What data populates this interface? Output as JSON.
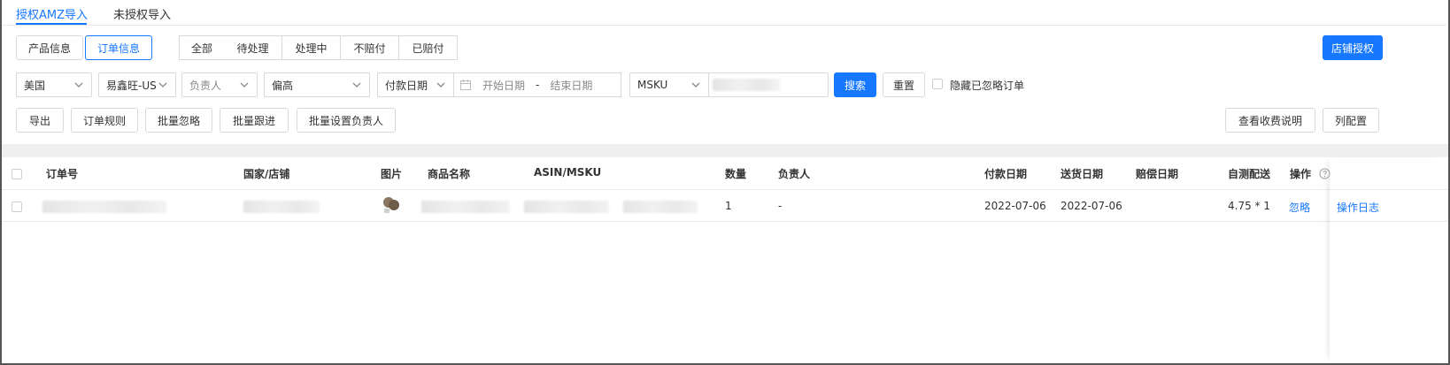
{
  "tabs": [
    {
      "label": "授权AMZ导入",
      "active": true
    },
    {
      "label": "未授权导入",
      "active": false
    }
  ],
  "view_toggle": {
    "product": "产品信息",
    "order": "订单信息"
  },
  "status_filter": [
    "全部",
    "待处理",
    "处理中",
    "不赔付",
    "已赔付"
  ],
  "store_auth_button": "店铺授权",
  "filters": {
    "country": "美国",
    "store": "易鑫旺-US",
    "owner_placeholder": "负责人",
    "type": "偏高",
    "date_type": "付款日期",
    "start_placeholder": "开始日期",
    "end_placeholder": "结束日期",
    "range_sep": "-",
    "sku_type": "MSKU",
    "search": "搜索",
    "reset": "重置",
    "hide_ignored": "隐藏已忽略订单"
  },
  "actions": [
    "导出",
    "订单规则",
    "批量忽略",
    "批量跟进",
    "批量设置负责人"
  ],
  "right_actions": {
    "fee_desc": "查看收费说明",
    "columns": "列配置"
  },
  "table": {
    "headers": {
      "order_no": "订单号",
      "country_store": "国家/店铺",
      "image": "图片",
      "product_name": "商品名称",
      "asin_msku": "ASIN/MSKU",
      "qty": "数量",
      "owner": "负责人",
      "pay_date": "付款日期",
      "ship_date": "送货日期",
      "comp_date": "赔偿日期",
      "self_test": "自测配送",
      "ops": "操作"
    },
    "rows": [
      {
        "qty": "1",
        "owner": "-",
        "pay_date": "2022-07-06",
        "ship_date": "2022-07-06",
        "comp_date": "",
        "self_test": "4.75 * 1",
        "ignore": "忽略",
        "log": "操作日志"
      }
    ]
  },
  "colors": {
    "accent": "#1677ff",
    "border": "#d9d9d9",
    "band": "#efefef"
  }
}
